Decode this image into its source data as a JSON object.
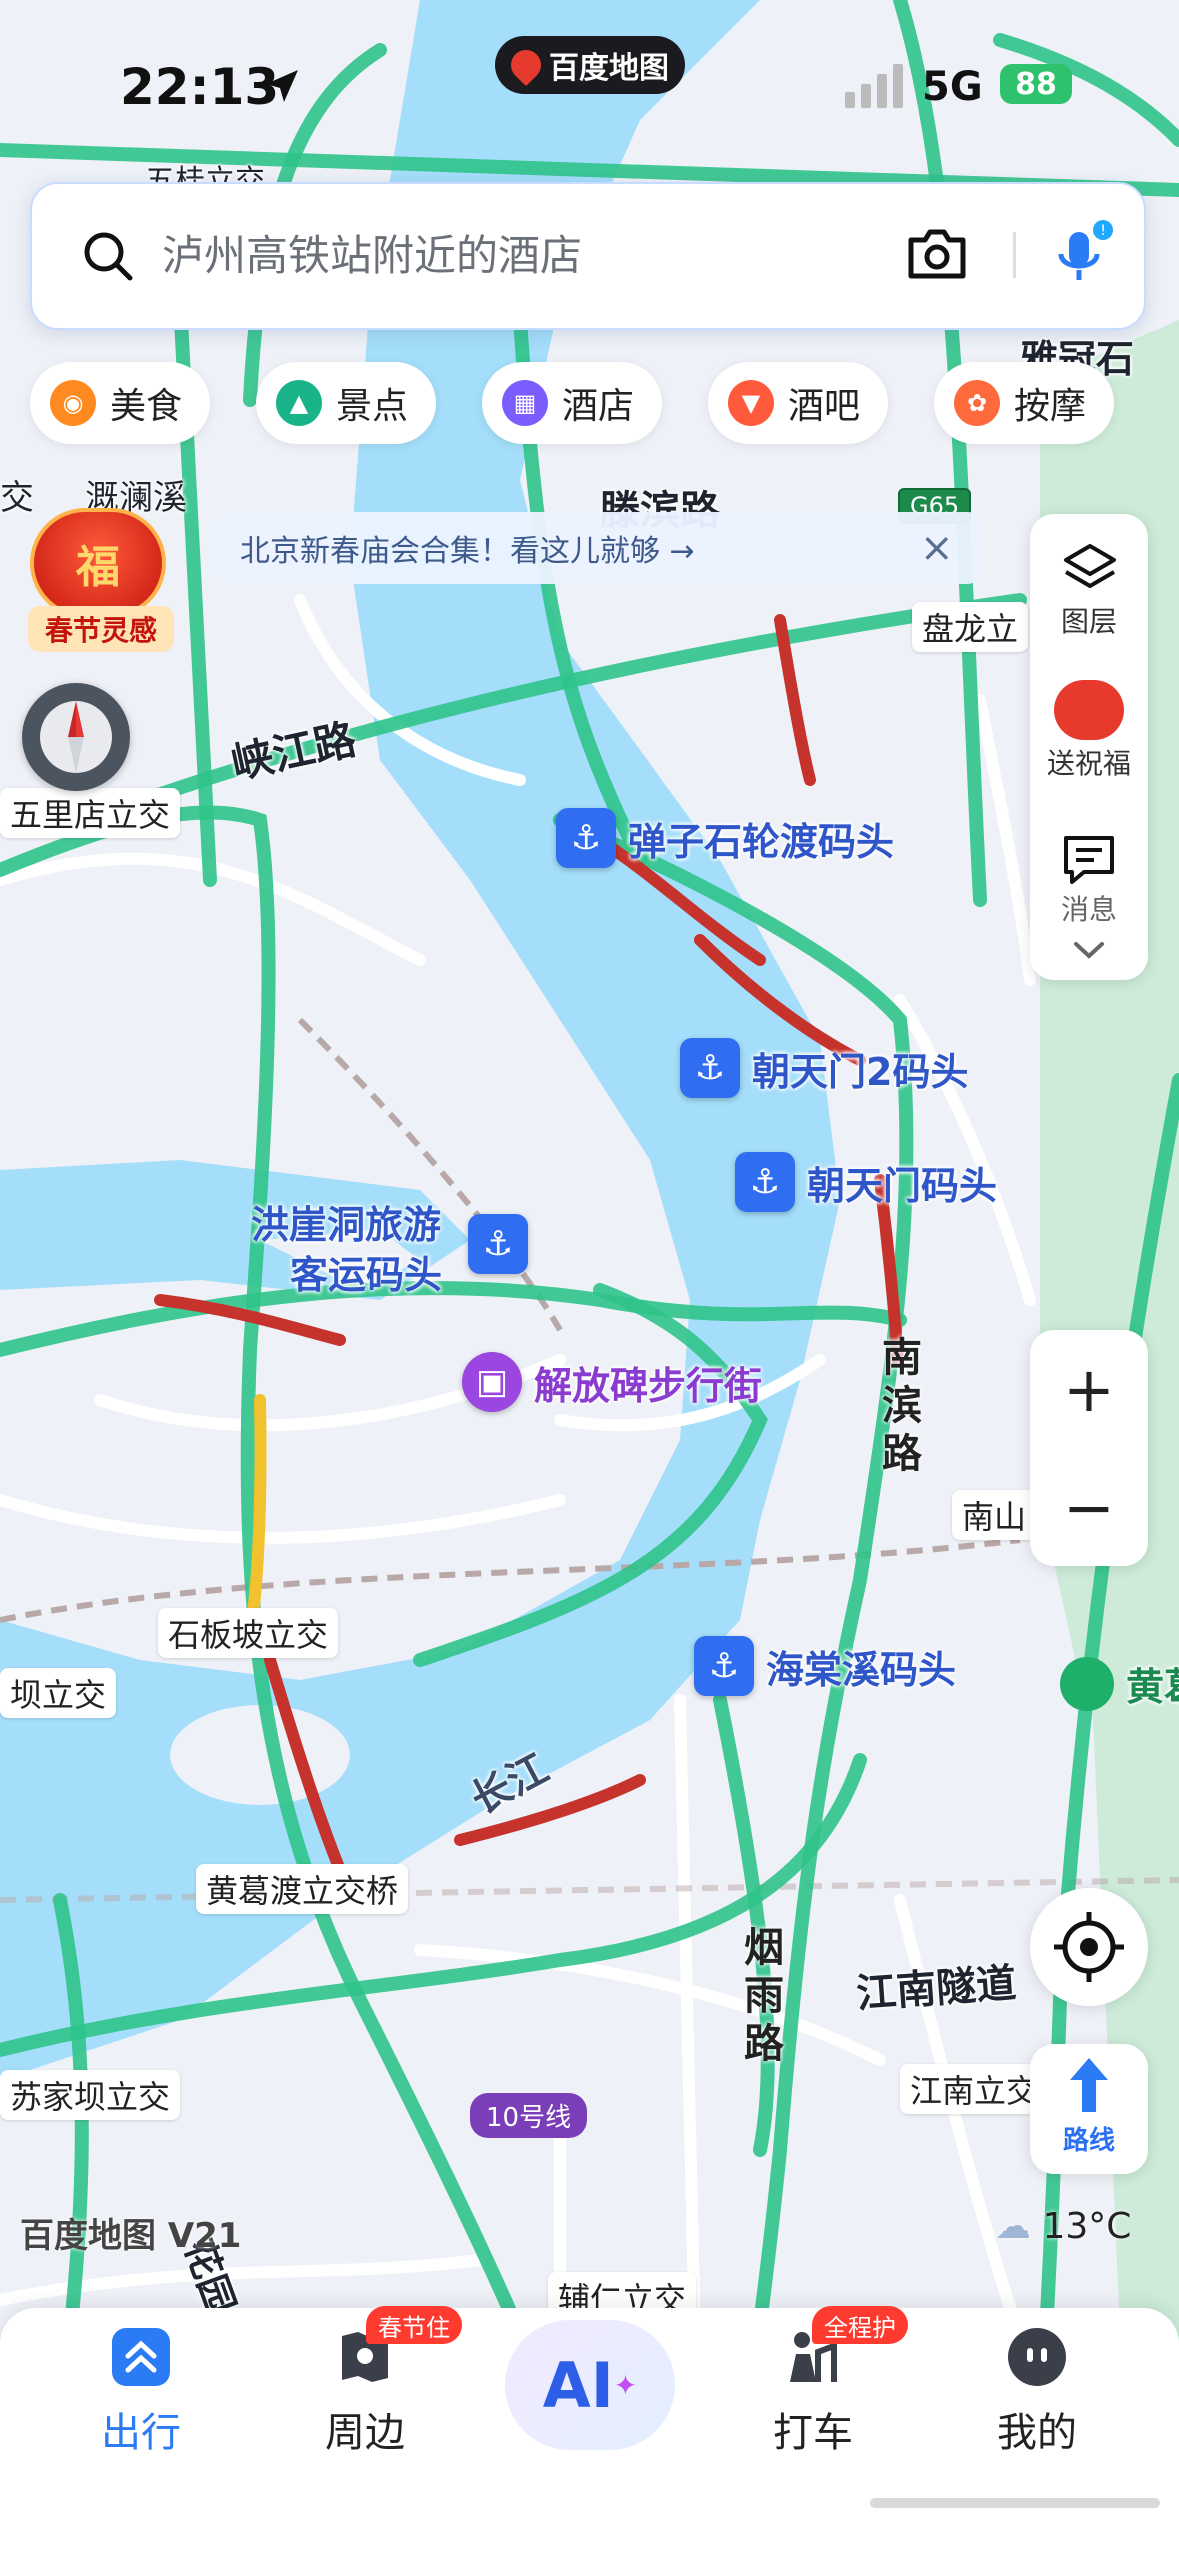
{
  "status": {
    "time": "22:13",
    "network": "5G",
    "battery": "88"
  },
  "brand": {
    "name": "百度地图"
  },
  "search": {
    "placeholder": "泸州高铁站附近的酒店"
  },
  "categories": [
    {
      "label": "美食",
      "color": "#ff8a1f"
    },
    {
      "label": "景点",
      "color": "#19b38a"
    },
    {
      "label": "酒店",
      "color": "#7a5cff"
    },
    {
      "label": "酒吧",
      "color": "#ff5a3c"
    },
    {
      "label": "按摩",
      "color": "#ff6a3d"
    }
  ],
  "notice": {
    "text": "北京新春庙会合集！看这儿就够 →",
    "close": "×"
  },
  "festival": {
    "glyph": "福",
    "label": "春节灵感"
  },
  "right_panel": {
    "layers": "图层",
    "blessing": "送祝福",
    "messages": "消息"
  },
  "zoom": {
    "in": "+",
    "out": "−"
  },
  "route": {
    "label": "路线"
  },
  "weather": {
    "temp": "13°C"
  },
  "map": {
    "roads": {
      "xiajiang": "峡江路",
      "tengbin": "滕滨路",
      "nanbin": [
        "南",
        "滨",
        "路"
      ],
      "yanyu": [
        "烟",
        "雨",
        "路"
      ],
      "jiangnan_tunnel": "江南隧道",
      "river": "长江"
    },
    "labels": {
      "wushi": "五桂立交",
      "wulidian": "五里店立交",
      "panlong": "盘龙立",
      "jilan": "溉澜溪",
      "jiao": "交",
      "nanshan": "南山",
      "shibanpo": "石板坡立交",
      "bali": "坝立交",
      "huangge_bridge": "黄葛渡立交桥",
      "sujiaba": "苏家坝立交",
      "jiangnanli": "江南立交",
      "furen": "辅仁立交",
      "huangge": "黄葛",
      "yanjiao": "雅冠石",
      "hua": "花园",
      "expressway": "G65",
      "metro": "10号线",
      "watermark": "百度地图 V21"
    },
    "pois": {
      "danzishi": "弹子石轮渡码头",
      "chaotianmen2": "朝天门2码头",
      "chaotianmen": "朝天门码头",
      "hongyadong": [
        "洪崖洞旅游",
        "客运码头"
      ],
      "jiefangbei": "解放碑步行街",
      "haitangxi": "海棠溪码头"
    }
  },
  "bottom_nav": {
    "items": [
      {
        "label": "出行",
        "active": true
      },
      {
        "label": "周边",
        "badge": "春节住"
      },
      {
        "label": "AI"
      },
      {
        "label": "打车",
        "badge": "全程护"
      },
      {
        "label": "我的"
      }
    ]
  }
}
